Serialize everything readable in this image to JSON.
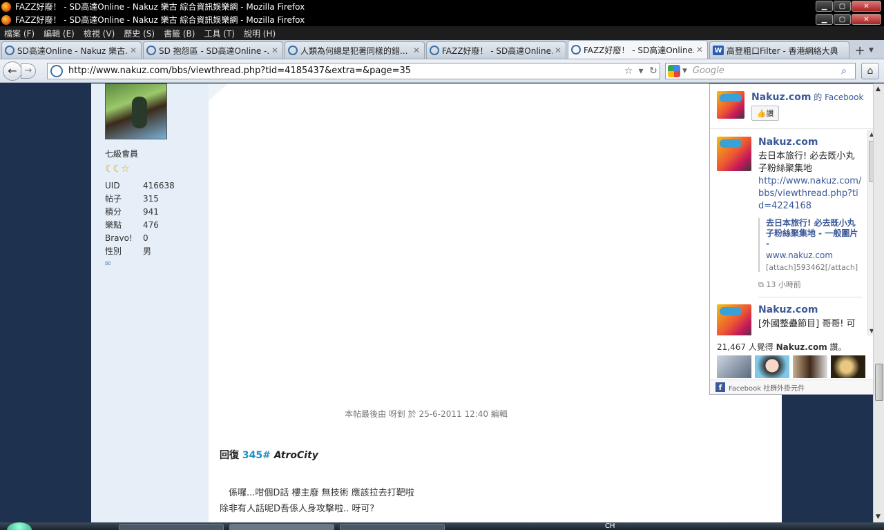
{
  "window": {
    "title_top": "FAZZ好廢！ - SD高達Online - Nakuz 樂古 綜合資訊娛樂網 - Mozilla Firefox",
    "title_second": "FAZZ好廢！ - SD高達Online - Nakuz 樂古 綜合資訊娛樂網 - Mozilla Firefox"
  },
  "menu": [
    "檔案 (F)",
    "編輯 (E)",
    "檢視 (V)",
    "歷史 (S)",
    "書籤 (B)",
    "工具 (T)",
    "說明 (H)"
  ],
  "tabs": [
    {
      "label": "SD高達Online - Nakuz 樂古...",
      "icon": "site-icon"
    },
    {
      "label": "SD 抱怨區 - SD高達Online -...",
      "icon": "site-icon"
    },
    {
      "label": "人類為何總是犯著同樣的錯...",
      "icon": "site-icon"
    },
    {
      "label": "FAZZ好廢！ - SD高達Online...",
      "icon": "site-icon"
    },
    {
      "label": "FAZZ好廢！ - SD高達Online...",
      "icon": "site-icon",
      "active": true
    },
    {
      "label": "高登粗口Filter - 香港網絡大典",
      "icon": "wiki-icon"
    }
  ],
  "nav": {
    "url": "http://www.nakuz.com/bbs/viewthread.php?tid=4185437&extra=&page=35",
    "search_placeholder": "Google"
  },
  "profile": {
    "rank": "七級會員",
    "stats": [
      {
        "k": "UID",
        "v": "416638"
      },
      {
        "k": "帖子",
        "v": "315"
      },
      {
        "k": "積分",
        "v": "941"
      },
      {
        "k": "樂點",
        "v": "476"
      },
      {
        "k": "Bravo!",
        "v": "0"
      },
      {
        "k": "性別",
        "v": "男"
      }
    ]
  },
  "post": {
    "edit_note": "本帖最後由 呀釗 於 25-6-2011 12:40 編輯",
    "reply_prefix": "回復",
    "reply_num": "345#",
    "reply_user": "AtroCity",
    "line1": "　係囉...咁個D話 樓主廢 無技術 應該拉去打靶啦",
    "line2": "除非有人話呢D吾係人身攻擊啦.. 呀可?"
  },
  "facebook": {
    "page_name": "Nakuz.com",
    "suffix": "的 Facebook",
    "like_label": "讚",
    "posts": [
      {
        "name": "Nakuz.com",
        "text": "去日本旅行! 必去既小丸子粉絲聚集地",
        "link": "http://www.nakuz.com/bbs/viewthread.php?tid=4224168",
        "attach_title": "去日本旅行! 必去既小丸子粉絲聚集地 - 一般圖片 -",
        "attach_site": "www.nakuz.com",
        "attach_text": "[attach]593462[/attach]",
        "time": "13 小時前"
      },
      {
        "name": "Nakuz.com",
        "text": "[外國整蠱節目] 哥哥! 可"
      }
    ],
    "count_prefix": "21,467 人覺得",
    "count_page": "Nakuz.com",
    "count_suffix": "讚。",
    "footer": "Facebook 社群外掛元件"
  },
  "taskbar": {
    "tray_text": "CH"
  }
}
